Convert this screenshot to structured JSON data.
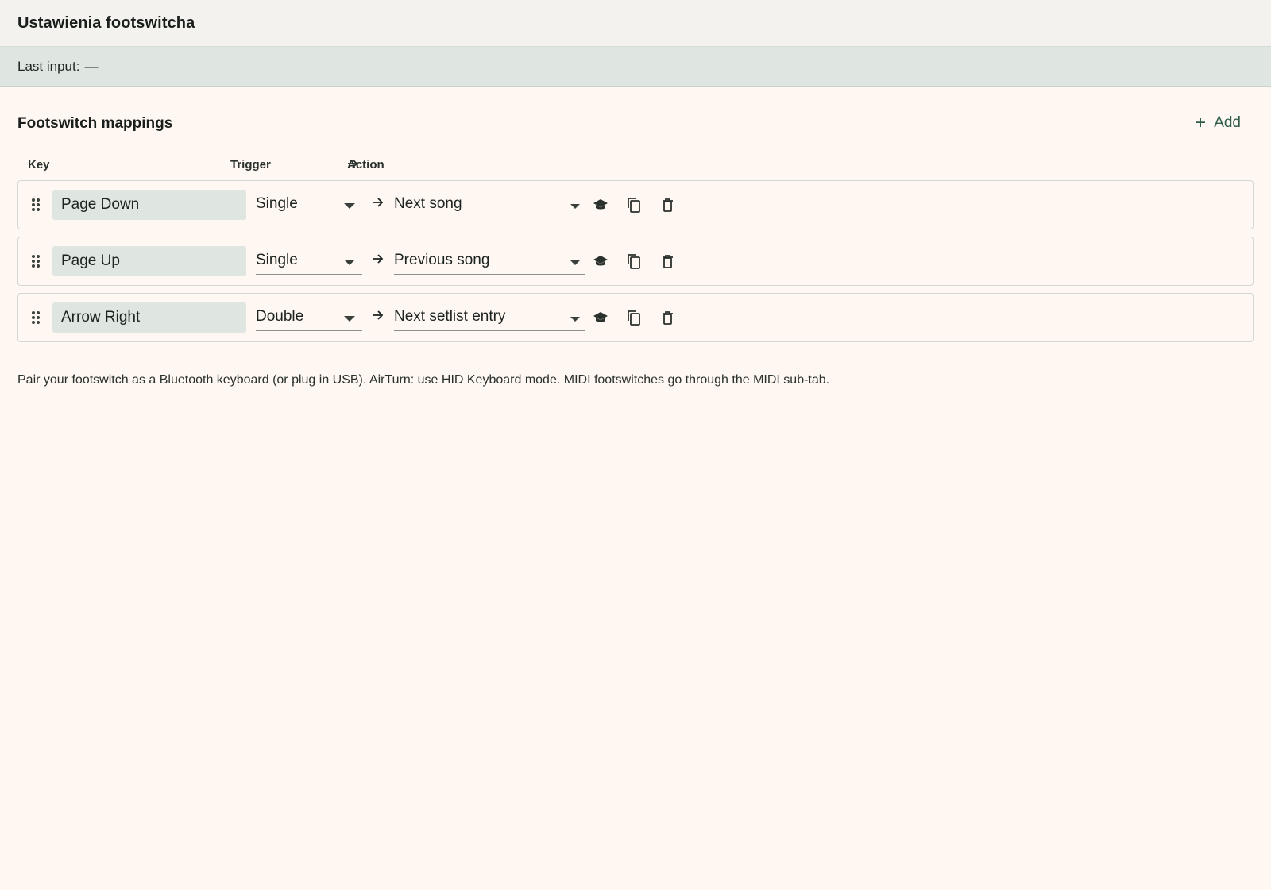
{
  "header": {
    "title": "Ustawienia footswitcha"
  },
  "status": {
    "label": "Last input:",
    "value": "—"
  },
  "section": {
    "title": "Footswitch mappings",
    "add_label": "Add"
  },
  "columns": {
    "key": "Key",
    "trigger": "Trigger",
    "action": "Action"
  },
  "mappings": [
    {
      "key": "Page Down",
      "trigger": "Single",
      "action": "Next song"
    },
    {
      "key": "Page Up",
      "trigger": "Single",
      "action": "Previous song"
    },
    {
      "key": "Arrow Right",
      "trigger": "Double",
      "action": "Next setlist entry"
    }
  ],
  "footnote": "Pair your footswitch as a Bluetooth keyboard (or plug in USB). AirTurn: use HID Keyboard mode. MIDI footswitches go through the MIDI sub-tab.",
  "icons": {
    "drag": "drag-handle-icon",
    "arrow": "arrow-right-icon",
    "learn": "learn-icon",
    "copy": "copy-icon",
    "delete": "delete-icon",
    "add": "plus-icon"
  },
  "colors": {
    "accent": "#2f5d48",
    "background": "#fef7f2",
    "status_bg": "#dfe5e0"
  }
}
